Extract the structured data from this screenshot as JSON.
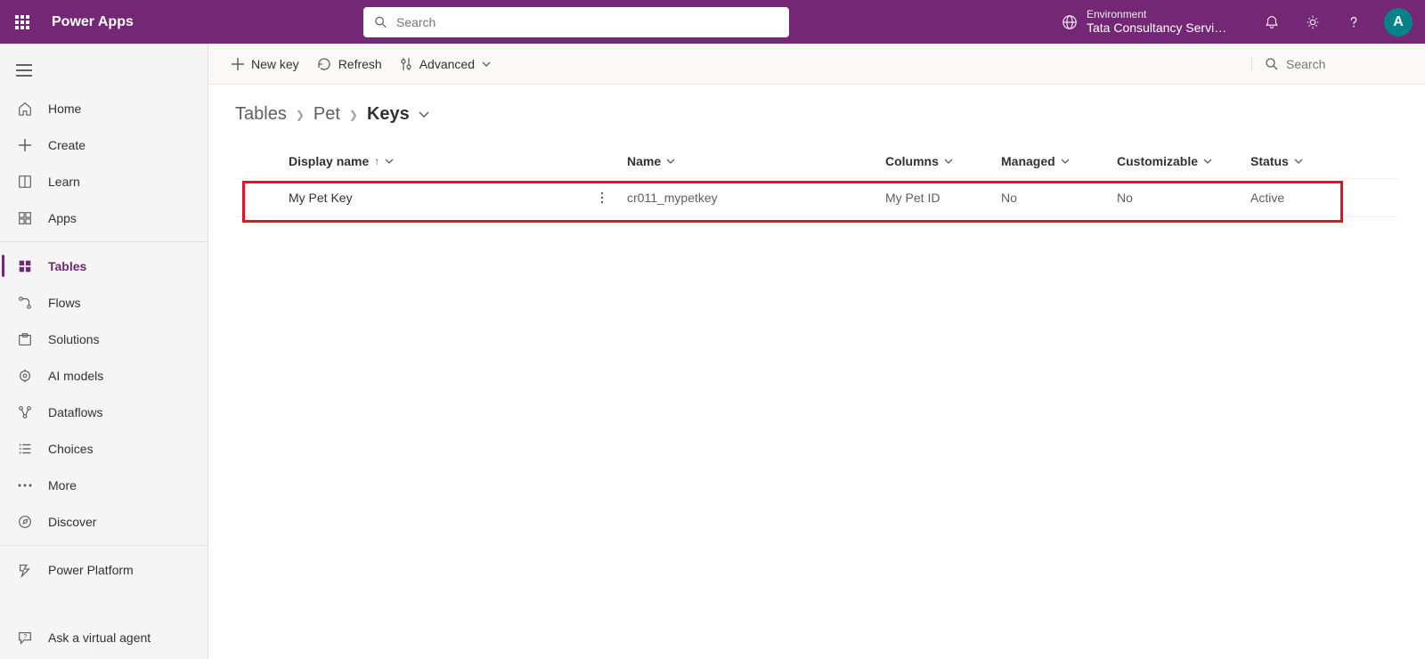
{
  "header": {
    "appTitle": "Power Apps",
    "searchPlaceholder": "Search",
    "envLabel": "Environment",
    "envName": "Tata Consultancy Servic...",
    "avatarInitials": "A"
  },
  "nav": {
    "home": "Home",
    "create": "Create",
    "learn": "Learn",
    "apps": "Apps",
    "tables": "Tables",
    "flows": "Flows",
    "solutions": "Solutions",
    "aimodels": "AI models",
    "dataflows": "Dataflows",
    "choices": "Choices",
    "more": "More",
    "discover": "Discover",
    "powerplatform": "Power Platform",
    "askagent": "Ask a virtual agent"
  },
  "cmdbar": {
    "newkey": "New key",
    "refresh": "Refresh",
    "advanced": "Advanced",
    "searchPlaceholder": "Search"
  },
  "breadcrumb": {
    "tables": "Tables",
    "pet": "Pet",
    "keys": "Keys"
  },
  "table": {
    "headers": {
      "displayName": "Display name",
      "name": "Name",
      "columns": "Columns",
      "managed": "Managed",
      "customizable": "Customizable",
      "status": "Status"
    },
    "rows": [
      {
        "displayName": "My Pet Key",
        "name": "cr011_mypetkey",
        "columns": "My Pet ID",
        "managed": "No",
        "customizable": "No",
        "status": "Active"
      }
    ]
  }
}
